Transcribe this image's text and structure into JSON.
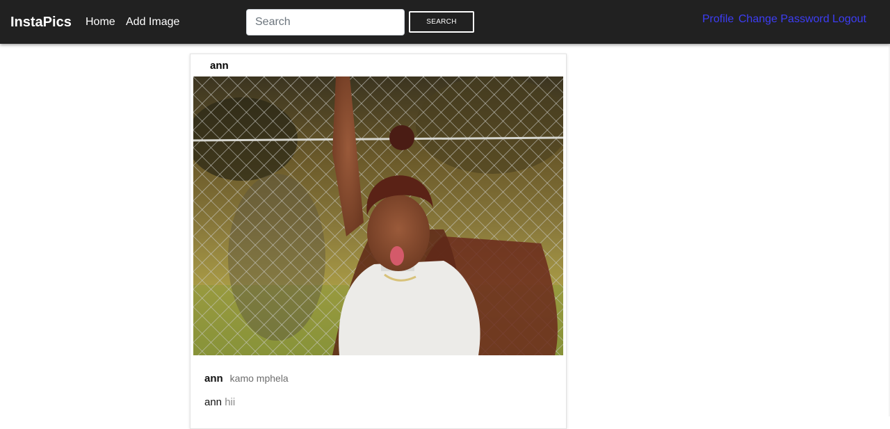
{
  "navbar": {
    "brand": "InstaPics",
    "links": [
      "Home",
      "Add Image"
    ],
    "search": {
      "placeholder": "Search",
      "value": "",
      "button_label": "SEARCH"
    },
    "right_links": [
      "Profile",
      "Change Password",
      "Logout"
    ]
  },
  "post": {
    "username": "ann",
    "caption_user": "ann",
    "caption": "kamo mphela",
    "comments": [
      {
        "user": "ann",
        "text": "hii"
      }
    ]
  },
  "colors": {
    "navbar_bg": "#212121",
    "accent_link": "#3d3df5"
  }
}
